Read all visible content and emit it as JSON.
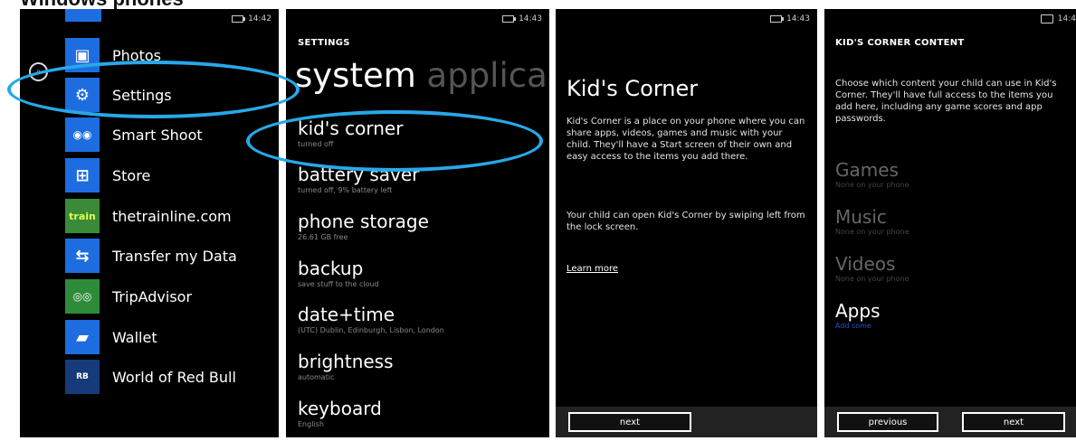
{
  "heading": "Windows phones",
  "screen1": {
    "time": "14:42",
    "apps": [
      {
        "name": "Photos",
        "glyph": "▣"
      },
      {
        "name": "Settings",
        "glyph": "⚙"
      },
      {
        "name": "Smart Shoot",
        "glyph": "◉◉"
      },
      {
        "name": "Store",
        "glyph": "⊞"
      },
      {
        "name": "thetrainline.com",
        "glyph": "train"
      },
      {
        "name": "Transfer my Data",
        "glyph": "⇆"
      },
      {
        "name": "TripAdvisor",
        "glyph": "◎◎"
      },
      {
        "name": "Wallet",
        "glyph": "▰"
      },
      {
        "name": "World of Red Bull",
        "glyph": "RB"
      }
    ]
  },
  "screen2": {
    "time": "14:43",
    "pretitle": "SETTINGS",
    "pivot_active": "system",
    "pivot_next": "applica",
    "items": [
      {
        "title": "kid's corner",
        "sub": "turned off"
      },
      {
        "title": "battery saver",
        "sub": "turned off, 9% battery left"
      },
      {
        "title": "phone storage",
        "sub": "26.61 GB free"
      },
      {
        "title": "backup",
        "sub": "save stuff to the cloud"
      },
      {
        "title": "date+time",
        "sub": "(UTC) Dublin, Edinburgh, Lisbon, London"
      },
      {
        "title": "brightness",
        "sub": "automatic"
      },
      {
        "title": "keyboard",
        "sub": "English"
      }
    ]
  },
  "screen3": {
    "time": "14:43",
    "title": "Kid's Corner",
    "para1": "Kid's Corner is a place on your phone where you can share apps, videos, games and music with your child. They'll have a Start screen of their own and easy access to the items you add there.",
    "para2": "Your child can open Kid's Corner by swiping left from the lock screen.",
    "link": "Learn more",
    "next": "next"
  },
  "screen4": {
    "time": "14:4",
    "title": "KID'S CORNER CONTENT",
    "para": "Choose which content your child can use in Kid's Corner. They'll have full access to the items you add here, including any game scores and app passwords.",
    "categories": [
      {
        "title": "Games",
        "sub": "None on your phone"
      },
      {
        "title": "Music",
        "sub": "None on your phone"
      },
      {
        "title": "Videos",
        "sub": "None on your phone"
      },
      {
        "title": "Apps",
        "sub": "Add some"
      }
    ],
    "previous": "previous",
    "next": "next"
  },
  "colors": {
    "accent": "#1e6de0",
    "highlight_ring": "#28a8e8"
  }
}
